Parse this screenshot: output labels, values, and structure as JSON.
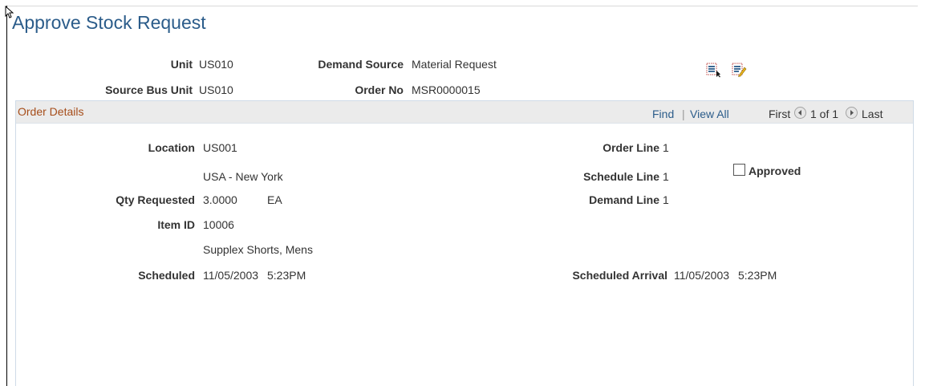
{
  "page": {
    "title": "Approve Stock Request"
  },
  "header": {
    "unit_label": "Unit",
    "unit_value": "US010",
    "demand_source_label": "Demand Source",
    "demand_source_value": "Material Request",
    "source_bus_unit_label": "Source Bus Unit",
    "source_bus_unit_value": "US010",
    "order_no_label": "Order No",
    "order_no_value": "MSR0000015",
    "icons": [
      "select-list-icon",
      "edit-list-icon"
    ]
  },
  "grid": {
    "title": "Order Details",
    "nav": {
      "find": "Find",
      "separator": "|",
      "view_all": "View All",
      "first": "First",
      "count": "1 of 1",
      "last": "Last"
    }
  },
  "details": {
    "location_label": "Location",
    "location_value": "US001",
    "location_desc": "USA - New York",
    "qty_label": "Qty Requested",
    "qty_value": "3.0000",
    "qty_uom": "EA",
    "item_label": "Item ID",
    "item_value": "10006",
    "item_desc": "Supplex Shorts, Mens",
    "scheduled_label": "Scheduled",
    "scheduled_date": "11/05/2003",
    "scheduled_time": "5:23PM",
    "order_line_label": "Order Line",
    "order_line_value": "1",
    "schedule_line_label": "Schedule Line",
    "schedule_line_value": "1",
    "demand_line_label": "Demand Line",
    "demand_line_value": "1",
    "approved_label": "Approved",
    "approved_checked": false,
    "sched_arrival_label": "Scheduled Arrival",
    "sched_arrival_date": "11/05/2003",
    "sched_arrival_time": "5:23PM"
  },
  "colors": {
    "title": "#2b5c8a",
    "grid_title": "#a64d1a",
    "link": "#2b5c8a",
    "grid_header_bg": "#ebebeb"
  }
}
